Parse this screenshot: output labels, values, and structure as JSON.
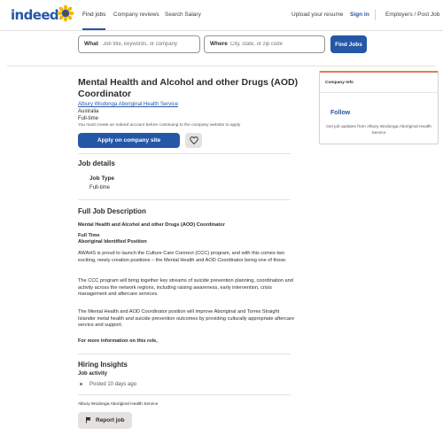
{
  "header": {
    "logo": "indeed",
    "nav": [
      "Find jobs",
      "Company reviews",
      "Search Salary"
    ],
    "upload_resume": "Upload your resume",
    "sign_in": "Sign in",
    "employers": "Employers / Post Job"
  },
  "search": {
    "what_label": "What",
    "what_placeholder": "Job title, keywords, or company",
    "where_label": "Where",
    "where_placeholder": "City, state, or zip code",
    "button": "Find Jobs"
  },
  "job": {
    "title": "Mental Health and Alcohol and other Drugs (AOD) Coordinator",
    "company": "Albury Wodonga Aboriginal Health Service",
    "location": "Australia",
    "job_type": "Full-time",
    "notice": "You must create an Indeed account before continuing to the company website to apply",
    "apply_button": "Apply on company site"
  },
  "details": {
    "heading": "Job details",
    "job_type_label": "Job Type",
    "job_type_value": "Full-time"
  },
  "description": {
    "heading": "Full Job Description",
    "title_line": "Mental Health and Alcohol and other Drugs (AOD) Coordinator",
    "line_full_time": "Full Time",
    "line_identified": "Aboriginal Identified Position",
    "p1": "AWAHS is proud to launch the Culture Care Connect (CCC) program, and with this comes two exciting, newly creation positions – the Mental Health and AOD Coordinator being one of those.",
    "p2": "The CCC program will bring together key streams of suicide prevention planning, coordination and activity across the network regions, including raising awareness, early intervention, crisis management and aftercare services.",
    "p3": "The Mental Health and AOD Coordinator position will improve Aboriginal and Torres Straight Islander metal health and suicide prevention outcomes by providing culturally appropriate aftercare service and support.",
    "more_info": "For more information on this role,"
  },
  "insights": {
    "heading": "Hiring Insights",
    "activity_label": "Job activity",
    "posted": "Posted 10 days ago"
  },
  "footer": {
    "company": "Albury Wodonga Aboriginal Health Service",
    "report_button": "Report job"
  },
  "company_card": {
    "heading": "Company Info",
    "follow": "Follow",
    "text": "Get job updates from Albury Wodonga Aboriginal Health Service"
  },
  "colors": {
    "brand_blue": "#2557a7",
    "card_accent": "#e07a52",
    "button_gray": "#e4e2e0"
  }
}
